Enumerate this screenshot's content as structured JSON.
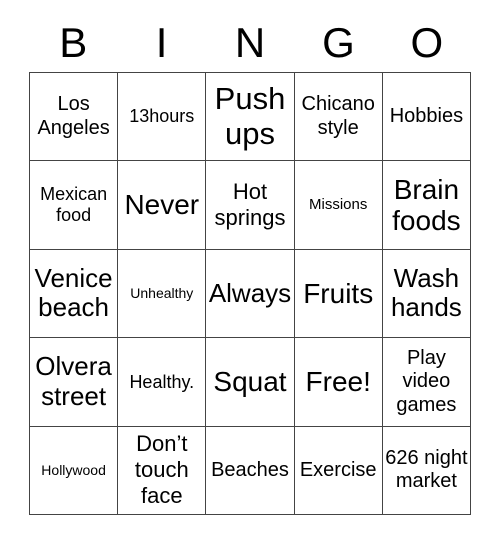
{
  "card": {
    "title": "BINGO",
    "header_letters": [
      "B",
      "I",
      "N",
      "G",
      "O"
    ],
    "free_space_label": "Free!",
    "colors": {
      "background": "#ffffff",
      "cell_background": "#ffffff",
      "border": "#444444",
      "text": "#000000"
    },
    "grid": {
      "columns": 5,
      "rows": 5,
      "cells": [
        {
          "text": "Los Angeles",
          "size": "lg"
        },
        {
          "text": "13hours",
          "size": "md"
        },
        {
          "text": "Push ups",
          "size": "4xl"
        },
        {
          "text": "Chicano style",
          "size": "lg"
        },
        {
          "text": "Hobbies",
          "size": "lg"
        },
        {
          "text": "Mexican food",
          "size": "md"
        },
        {
          "text": "Never",
          "size": "3xl"
        },
        {
          "text": "Hot springs",
          "size": "xl"
        },
        {
          "text": "Missions",
          "size": "sm"
        },
        {
          "text": "Brain foods",
          "size": "3xl"
        },
        {
          "text": "Venice beach",
          "size": "2xl"
        },
        {
          "text": "Unhealthy",
          "size": "xs"
        },
        {
          "text": "Always",
          "size": "2xl"
        },
        {
          "text": "Fruits",
          "size": "3xl"
        },
        {
          "text": "Wash hands",
          "size": "2xl"
        },
        {
          "text": "Olvera street",
          "size": "2xl"
        },
        {
          "text": "Healthy.",
          "size": "md"
        },
        {
          "text": "Squat",
          "size": "3xl"
        },
        {
          "text": "Free!",
          "size": "3xl"
        },
        {
          "text": "Play video games",
          "size": "lg"
        },
        {
          "text": "Hollywood",
          "size": "xs"
        },
        {
          "text": "Don’t touch face",
          "size": "xl"
        },
        {
          "text": "Beaches",
          "size": "lg"
        },
        {
          "text": "Exercise",
          "size": "lg"
        },
        {
          "text": "626 night market",
          "size": "lg"
        }
      ]
    }
  }
}
